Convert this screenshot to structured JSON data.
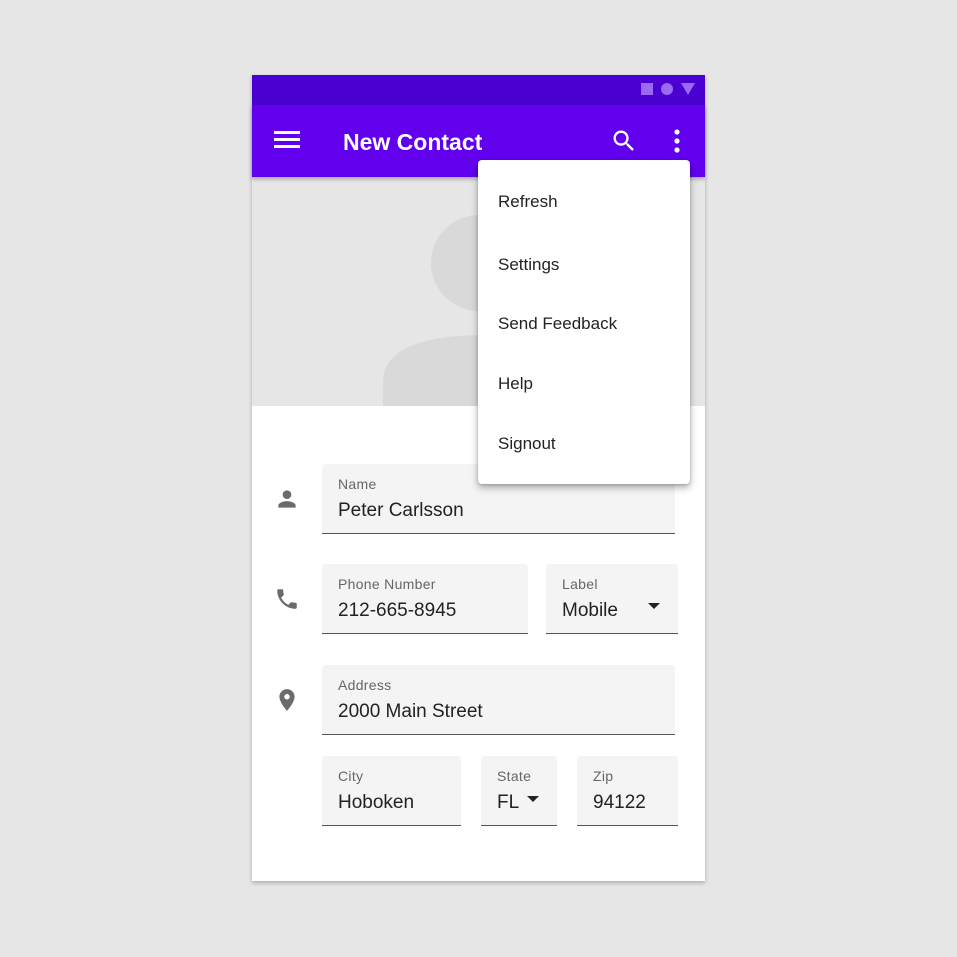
{
  "app": {
    "title": "New Contact",
    "status_icons": [
      "square-icon",
      "circle-icon",
      "triangle-icon"
    ],
    "colors": {
      "primary": "#6200ee",
      "primary_dark": "#4a00d0",
      "surface": "#ffffff",
      "field_bg": "#f4f4f4"
    }
  },
  "appbar": {
    "menu_icon": "hamburger-menu-icon",
    "search_icon": "search-icon",
    "more_icon": "more-vert-icon"
  },
  "overflow_menu": {
    "items": [
      {
        "label": "Refresh"
      },
      {
        "label": "Settings"
      },
      {
        "label": "Send Feedback"
      },
      {
        "label": "Help"
      },
      {
        "label": "Signout"
      }
    ]
  },
  "form": {
    "name": {
      "label": "Name",
      "value": "Peter Carlsson"
    },
    "phone": {
      "label": "Phone Number",
      "value": "212-665-8945"
    },
    "phone_label": {
      "label": "Label",
      "value": "Mobile"
    },
    "address": {
      "label": "Address",
      "value": "2000 Main Street"
    },
    "city": {
      "label": "City",
      "value": "Hoboken"
    },
    "state": {
      "label": "State",
      "value": "FL"
    },
    "zip": {
      "label": "Zip",
      "value": "94122"
    }
  }
}
